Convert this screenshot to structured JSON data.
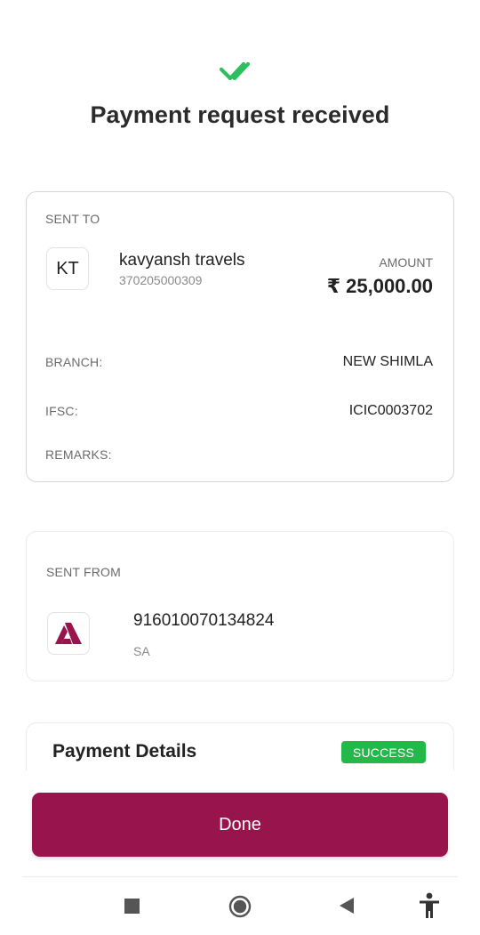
{
  "header": {
    "status_icon": "double-check-icon",
    "title": "Payment request received",
    "accent_color": "#2dbe60"
  },
  "sent_to": {
    "section_label": "SENT TO",
    "avatar_initials": "KT",
    "payee_name": "kavyansh travels",
    "account_number": "370205000309",
    "amount_label": "AMOUNT",
    "amount_value": "₹ 25,000.00",
    "details": [
      {
        "label": "BRANCH:",
        "value": "NEW SHIMLA"
      },
      {
        "label": "IFSC:",
        "value": "ICIC0003702"
      },
      {
        "label": "REMARKS:",
        "value": ""
      }
    ]
  },
  "sent_from": {
    "section_label": "SENT FROM",
    "bank_logo": "axis-bank-logo",
    "account_number": "916010070134824",
    "account_type": "SA"
  },
  "payment_details": {
    "title": "Payment Details",
    "status": "SUCCESS",
    "status_color": "#22b84a"
  },
  "actions": {
    "done_label": "Done",
    "brand_color": "#97144d"
  },
  "nav_bar": {
    "items": [
      "recents-square-icon",
      "home-circle-icon",
      "back-triangle-icon",
      "accessibility-icon"
    ]
  }
}
